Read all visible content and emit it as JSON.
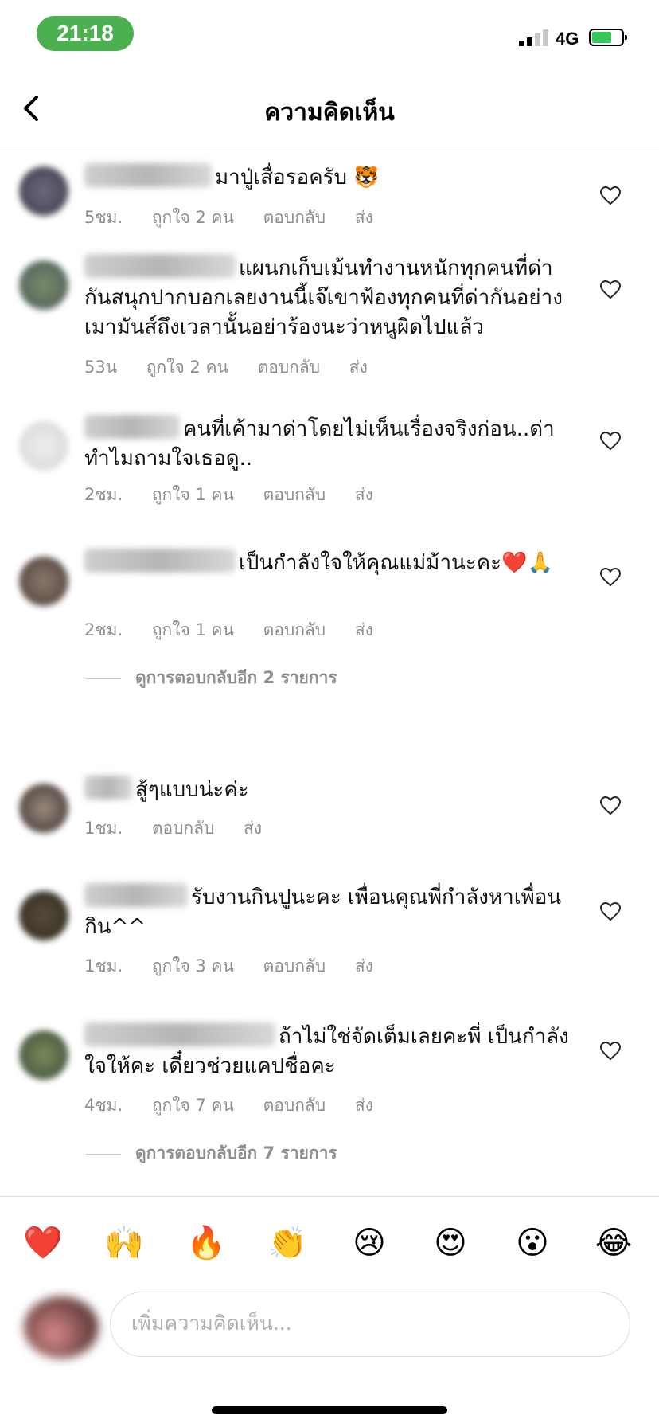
{
  "status_bar": {
    "time": "21:18",
    "network": "4G"
  },
  "header": {
    "title": "ความคิดเห็น"
  },
  "comments": [
    {
      "text": "มาปู่เสื่อรอครับ 🐯",
      "time": "5ชม.",
      "likes": "ถูกใจ 2 คน",
      "reply": "ตอบกลับ",
      "send": "ส่ง"
    },
    {
      "text": "แผนกเก็บเม้นทำงานหนักทุกคนที่ด่ากันสนุกปากบอกเลยงานนี้เจ๊เขาฟ้องทุกคนที่ด่ากันอย่างเมามันส์ถึงเวลานั้นอย่าร้องนะว่าหนูผิดไปแล้ว",
      "time": "53น",
      "likes": "ถูกใจ 2 คน",
      "reply": "ตอบกลับ",
      "send": "ส่ง"
    },
    {
      "text": "คนที่เค้ามาด่าโดยไม่เห็นเรื่องจริงก่อน..ด่าทำไมถามใจเธอดู..",
      "time": "2ชม.",
      "likes": "ถูกใจ 1 คน",
      "reply": "ตอบกลับ",
      "send": "ส่ง"
    },
    {
      "text": "เป็นกำลังใจให้คุณแม่ม้านะคะ❤️🙏",
      "time": "2ชม.",
      "likes": "ถูกใจ 1 คน",
      "reply": "ตอบกลับ",
      "send": "ส่ง",
      "view_replies": "ดูการตอบกลับอีก 2 รายการ"
    },
    {
      "text": "สู้ๆแบบน่ะค่ะ",
      "time": "1ชม.",
      "likes": "",
      "reply": "ตอบกลับ",
      "send": "ส่ง"
    },
    {
      "text": "รับงานกินปูนะคะ เพื่อนคุณพี่กำลังหาเพื่อนกิน^^",
      "time": "1ชม.",
      "likes": "ถูกใจ 3 คน",
      "reply": "ตอบกลับ",
      "send": "ส่ง"
    },
    {
      "text": "ถ้าไม่ใช่จัดเต็มเลยคะพี่ เป็นกำลังใจให้คะ เดี๋ยวช่วยแคปชื่อคะ",
      "time": "4ชม.",
      "likes": "ถูกใจ 7 คน",
      "reply": "ตอบกลับ",
      "send": "ส่ง",
      "view_replies": "ดูการตอบกลับอีก 7 รายการ"
    }
  ],
  "emoji_bar": [
    "❤️",
    "🙌",
    "🔥",
    "👏",
    "😢",
    "😍",
    "😮",
    "😂"
  ],
  "input": {
    "placeholder": "เพิ่มความคิดเห็น..."
  },
  "colors": {
    "status_pill": "#4caf50",
    "meta_text": "#8e8e8e",
    "divider": "#dbdbdb"
  }
}
